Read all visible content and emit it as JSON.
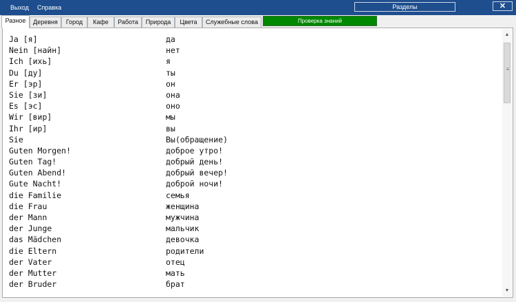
{
  "menu": [
    "Выход",
    "Справка"
  ],
  "sections_label": "Разделы",
  "close_label": "✕",
  "tabs": [
    {
      "label": "Разное",
      "active": true
    },
    {
      "label": "Деревня",
      "active": false
    },
    {
      "label": "Город",
      "active": false
    },
    {
      "label": "Кафе",
      "active": false
    },
    {
      "label": "Работа",
      "active": false
    },
    {
      "label": "Природа",
      "active": false
    },
    {
      "label": "Цвета",
      "active": false
    },
    {
      "label": "Служебные слова",
      "active": false
    }
  ],
  "quiz_label": "Проверка знаний",
  "words": [
    {
      "de": "Ja [я]",
      "ru": "да"
    },
    {
      "de": "Nein [найн]",
      "ru": "нет"
    },
    {
      "de": "Ich [ихь]",
      "ru": "я"
    },
    {
      "de": "Du [ду]",
      "ru": "ты"
    },
    {
      "de": "Er [эр]",
      "ru": "он"
    },
    {
      "de": "Sie [зи]",
      "ru": "она"
    },
    {
      "de": "Es [эс]",
      "ru": "оно"
    },
    {
      "de": "Wir [вир]",
      "ru": "мы"
    },
    {
      "de": "Ihr [ир]",
      "ru": "вы"
    },
    {
      "de": "Sie",
      "ru": "Вы(обращение)"
    },
    {
      "de": "Guten Morgen!",
      "ru": "доброе утро!"
    },
    {
      "de": "Guten Tag!",
      "ru": "добрый день!"
    },
    {
      "de": "Guten Abend!",
      "ru": "добрый вечер!"
    },
    {
      "de": "Gute Nacht!",
      "ru": "доброй ночи!"
    },
    {
      "de": "die Familie",
      "ru": "семья"
    },
    {
      "de": "die Frau",
      "ru": "женщина"
    },
    {
      "de": "der Mann",
      "ru": "мужчина"
    },
    {
      "de": "der Junge",
      "ru": "мальчик"
    },
    {
      "de": "das Mädchen",
      "ru": "девочка"
    },
    {
      "de": "die Eltern",
      "ru": "родители"
    },
    {
      "de": "der Vater",
      "ru": "отец"
    },
    {
      "de": "der Mutter",
      "ru": "мать"
    },
    {
      "de": "der Bruder",
      "ru": "брат"
    }
  ],
  "colors": {
    "titlebar": "#1e4e8e",
    "quiz": "#008800"
  }
}
